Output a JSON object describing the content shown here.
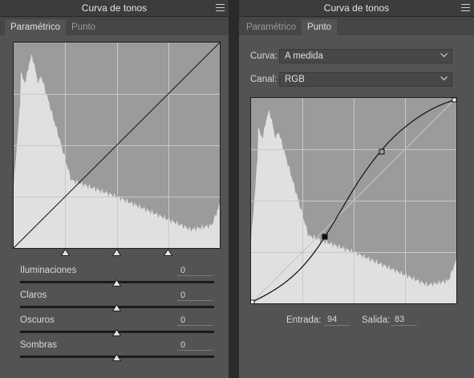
{
  "left": {
    "title": "Curva de tonos",
    "tabs": [
      {
        "label": "Paramétrico",
        "active": true
      },
      {
        "label": "Punto",
        "active": false
      }
    ],
    "sliders": [
      {
        "label": "Iluminaciones",
        "value": "0"
      },
      {
        "label": "Claros",
        "value": "0"
      },
      {
        "label": "Oscuros",
        "value": "0"
      },
      {
        "label": "Sombras",
        "value": "0"
      }
    ]
  },
  "right": {
    "title": "Curva de tonos",
    "tabs": [
      {
        "label": "Paramétrico",
        "active": false
      },
      {
        "label": "Punto",
        "active": true
      }
    ],
    "curve_label": "Curva:",
    "curve_value": "A medida",
    "channel_label": "Canal:",
    "channel_value": "RGB",
    "input_label": "Entrada:",
    "input_value": "94",
    "output_label": "Salida:",
    "output_value": "83"
  },
  "colors": {
    "panel": "#535353",
    "histogram_bg": "#9b9b9b",
    "histogram_fill": "#e0e0e0",
    "grid": "#c8c8c8"
  },
  "icons": {
    "panel_menu": "hamburger-menu-icon",
    "dropdown": "chevron-down-icon",
    "slider_thumb": "triangle-up-icon"
  }
}
